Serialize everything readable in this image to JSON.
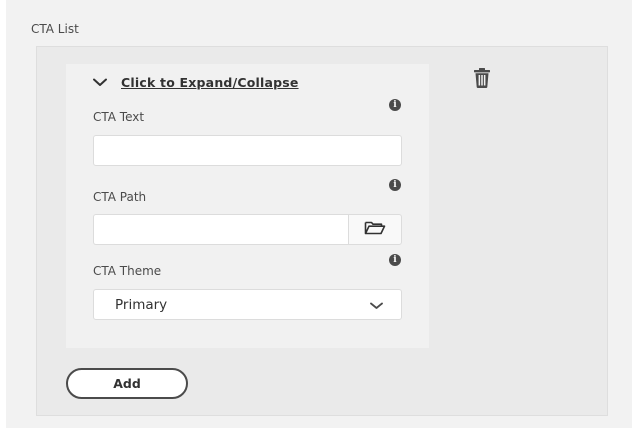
{
  "multifield": {
    "label": "CTA List",
    "add_label": "Add"
  },
  "item": {
    "collapse_link": "Click to Expand/Collapse",
    "fields": {
      "text": {
        "label": "CTA Text",
        "value": "",
        "placeholder": ""
      },
      "path": {
        "label": "CTA Path",
        "value": "",
        "placeholder": ""
      },
      "theme": {
        "label": "CTA Theme",
        "selected": "Primary"
      }
    }
  },
  "icons": {
    "collapse": "chevron-down-icon",
    "delete": "trash-icon",
    "info": "info-icon",
    "browse": "folder-icon",
    "dropdown": "chevron-down-icon"
  },
  "info_glyph": "i",
  "colors": {
    "panel_bg": "#f2f2f2",
    "multifield_bg": "#eaeaea",
    "card_bg": "#f1f1f1",
    "text": "#4b4b4b",
    "link": "#323232"
  }
}
